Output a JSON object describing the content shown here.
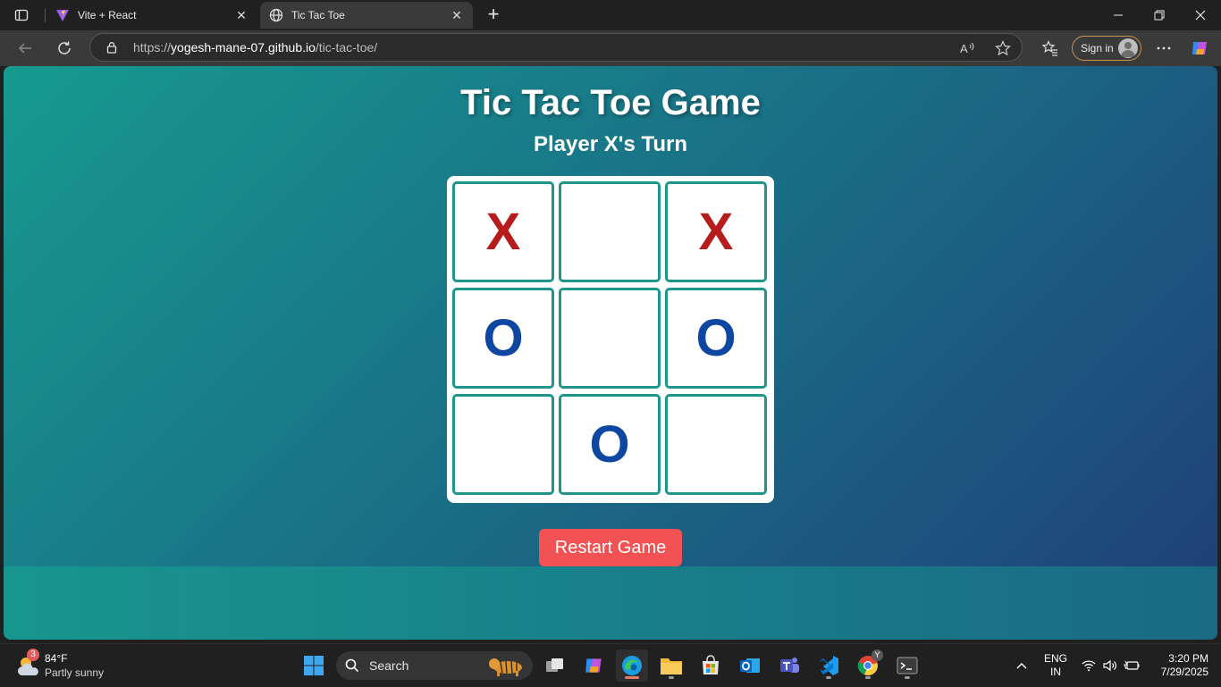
{
  "browser": {
    "tabs": [
      {
        "title": "Vite + React",
        "active": false,
        "favicon": "vite-logo-icon"
      },
      {
        "title": "Tic Tac Toe",
        "active": true,
        "favicon": "globe-icon"
      }
    ],
    "address": {
      "protocol": "https://",
      "host": "yogesh-mane-07.github.io",
      "path": "/tic-tac-toe/"
    },
    "signin_label": "Sign in"
  },
  "page": {
    "title": "Tic Tac Toe Game",
    "status": "Player X's Turn",
    "board": [
      "X",
      "",
      "X",
      "O",
      "",
      "O",
      "",
      "O",
      ""
    ],
    "restart_label": "Restart Game",
    "colors": {
      "x": "#b71c1c",
      "o": "#0d47a1",
      "cell_border": "#1f968b",
      "button": "#f25253"
    }
  },
  "taskbar": {
    "weather": {
      "badge": "3",
      "temp": "84°F",
      "condition": "Partly sunny"
    },
    "search_label": "Search",
    "language": [
      "ENG",
      "IN"
    ],
    "time": "3:20 PM",
    "date": "7/29/2025",
    "chrome_badge": "Y"
  }
}
